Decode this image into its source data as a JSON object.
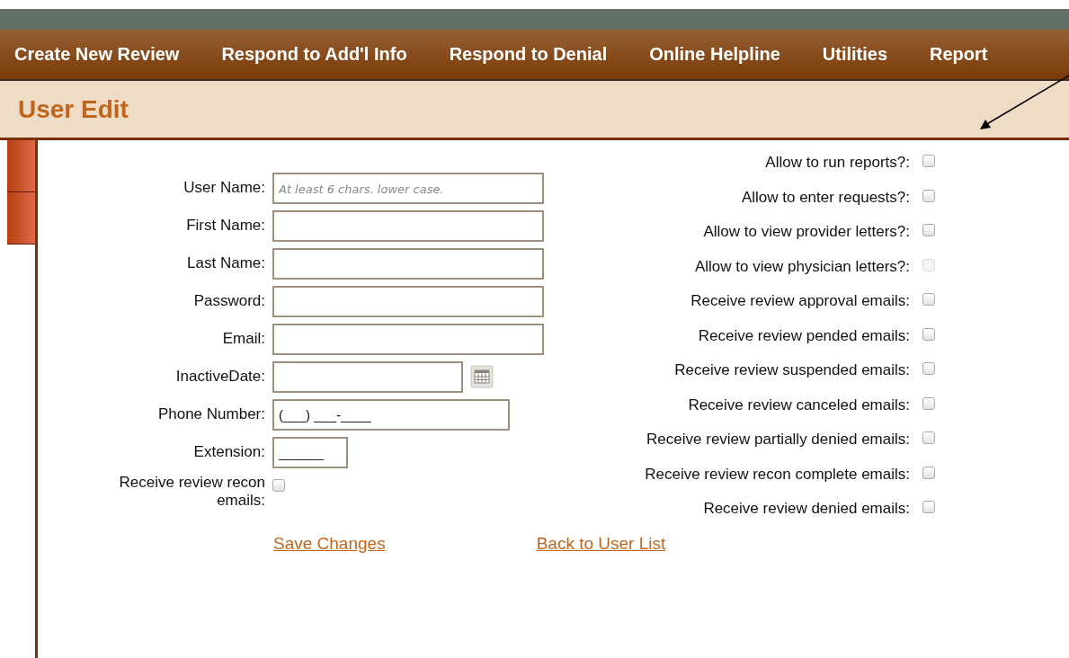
{
  "nav": {
    "items": [
      {
        "label": "Create New Review"
      },
      {
        "label": "Respond to Add'l Info"
      },
      {
        "label": "Respond to Denial"
      },
      {
        "label": "Online Helpline"
      },
      {
        "label": "Utilities"
      },
      {
        "label": "Report"
      }
    ]
  },
  "page_title": "User Edit",
  "left_fields": [
    {
      "kind": "text",
      "label": "User Name:",
      "placeholder": "At least 6 chars. lower case."
    },
    {
      "kind": "text",
      "label": "First Name:"
    },
    {
      "kind": "text",
      "label": "Last Name:"
    },
    {
      "kind": "text",
      "label": "Password:"
    },
    {
      "kind": "text",
      "label": "Email:"
    },
    {
      "kind": "date",
      "label": "InactiveDate:"
    },
    {
      "kind": "phone",
      "label": "Phone Number:",
      "value": "(___) ___-____"
    },
    {
      "kind": "extension",
      "label": "Extension:",
      "value": "______"
    },
    {
      "kind": "checkbox",
      "label": "Receive review recon emails:",
      "checked": false,
      "disabled": false
    }
  ],
  "right_options": [
    {
      "label": "Allow to run reports?:",
      "checked": false,
      "disabled": false
    },
    {
      "label": "Allow to enter requests?:",
      "checked": false,
      "disabled": false
    },
    {
      "label": "Allow to view provider letters?:",
      "checked": false,
      "disabled": false
    },
    {
      "label": "Allow to view physician letters?:",
      "checked": false,
      "disabled": true
    },
    {
      "label": "Receive review approval emails:",
      "checked": false,
      "disabled": false
    },
    {
      "label": "Receive review pended emails:",
      "checked": false,
      "disabled": false
    },
    {
      "label": "Receive review suspended emails:",
      "checked": false,
      "disabled": false
    },
    {
      "label": "Receive review canceled emails:",
      "checked": false,
      "disabled": false
    },
    {
      "label": "Receive review partially denied emails:",
      "checked": false,
      "disabled": false
    },
    {
      "label": "Receive review recon complete emails:",
      "checked": false,
      "disabled": false
    },
    {
      "label": "Receive review denied emails:",
      "checked": false,
      "disabled": false
    }
  ],
  "links": [
    {
      "label": "Save Changes"
    },
    {
      "label": "Back to User List"
    }
  ]
}
